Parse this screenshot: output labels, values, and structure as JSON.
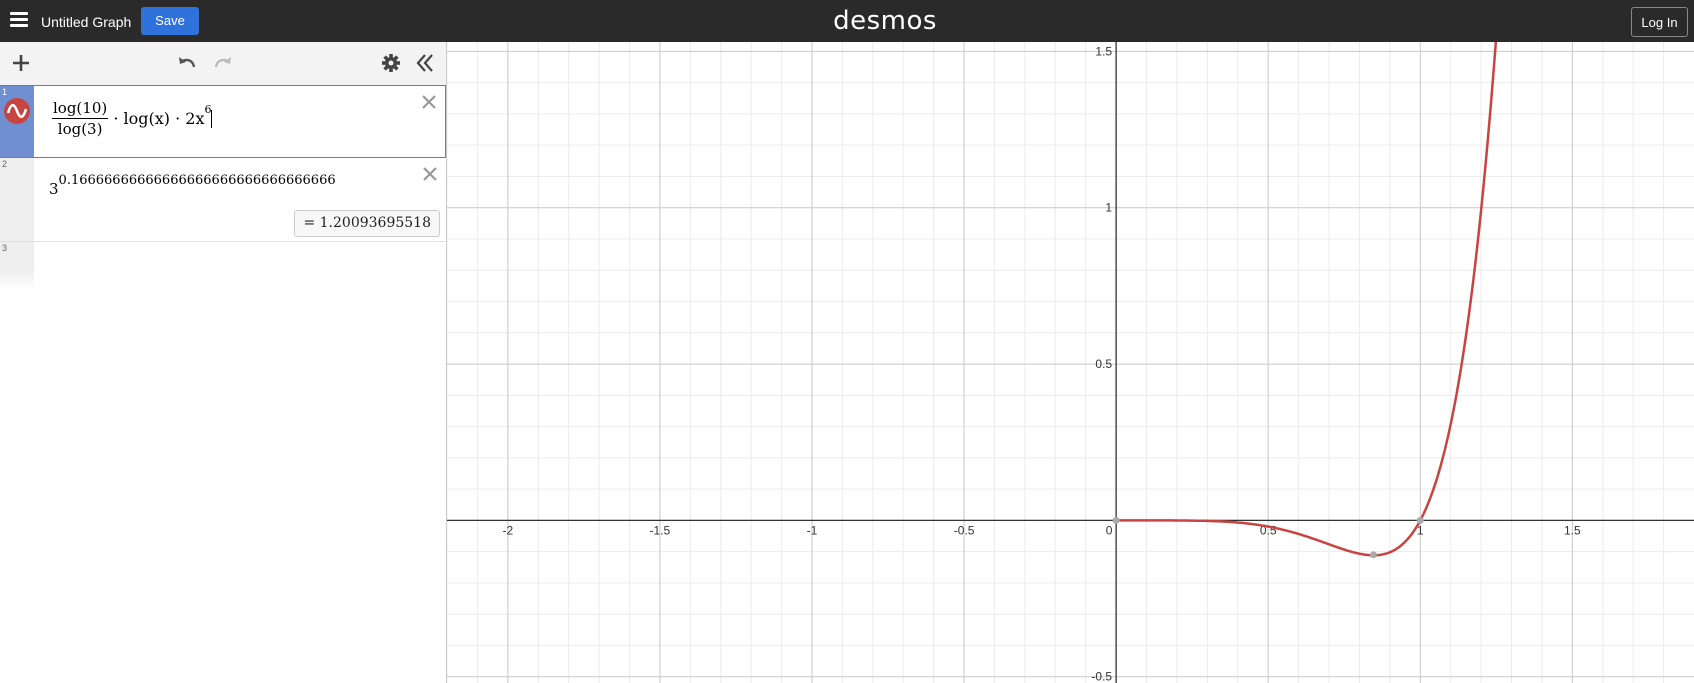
{
  "header": {
    "title": "Untitled Graph",
    "save_label": "Save",
    "logo": "desmos",
    "login_label": "Log In"
  },
  "toolbar": {
    "icons": [
      "plus-icon",
      "undo-icon",
      "redo-icon",
      "gear-icon",
      "collapse-icon"
    ]
  },
  "expressions": [
    {
      "num": "1",
      "latex": "\\frac{\\log(10)}{\\log(3)}\\cdot\\log(x)\\cdot2x^{6}",
      "frac_num": "log(10)",
      "frac_den": "log(3)",
      "rest_a": "· log(x) · 2x",
      "exp": "6",
      "color": "#c74440",
      "active": true
    },
    {
      "num": "2",
      "base": "3",
      "exp": "0.16666666666666666666666666666666",
      "result": "= 1.20093695518"
    },
    {
      "num": "3"
    }
  ],
  "graph": {
    "x_ticks": [
      "-2",
      "-1.5",
      "-1",
      "-0.5",
      "0",
      "0.5",
      "1",
      "1.5"
    ],
    "y_ticks": [
      "1.5",
      "1",
      "0.5",
      "-0.5"
    ],
    "xlim": [
      -2.2,
      1.9
    ],
    "ylim": [
      -0.52,
      1.53
    ],
    "curve_color": "#c74440",
    "grid": true,
    "points_of_interest": [
      {
        "x": 0,
        "y": 0
      },
      {
        "x": 0.846,
        "y": -0.11
      },
      {
        "x": 1,
        "y": 0
      }
    ]
  }
}
